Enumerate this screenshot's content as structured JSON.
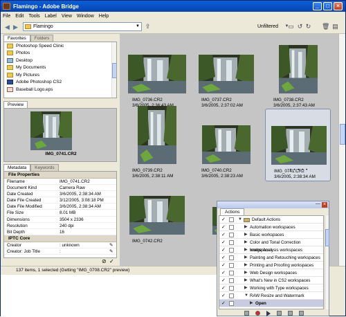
{
  "window": {
    "title": "Flamingo - Adobe Bridge"
  },
  "menu": [
    "File",
    "Edit",
    "Tools",
    "Label",
    "View",
    "Window",
    "Help"
  ],
  "toolbar": {
    "path": "Flamingo",
    "filter": "Unfiltered"
  },
  "favorites": {
    "tabs": [
      "Favorites",
      "Folders"
    ],
    "items": [
      {
        "label": "Photoshop Speed Clinic",
        "icon": "folder-icon"
      },
      {
        "label": "Photos",
        "icon": "folder-icon"
      },
      {
        "label": "Desktop",
        "icon": "desktop-icon"
      },
      {
        "label": "My Documents",
        "icon": "folder-icon"
      },
      {
        "label": "My Pictures",
        "icon": "folder-icon"
      },
      {
        "label": "Adobe Photoshop CS2",
        "icon": "application-icon"
      },
      {
        "label": "Baseball Logo.eps",
        "icon": "eps-file-icon"
      }
    ]
  },
  "preview": {
    "tab": "Preview",
    "caption": "IMG_0741.CR2"
  },
  "metadata": {
    "tabs": [
      "Metadata",
      "Keywords"
    ],
    "sections": [
      {
        "title": "File Properties",
        "rows": [
          [
            "Filename",
            "IMG_0741.CR2"
          ],
          [
            "Document Kind",
            "Camera Raw"
          ],
          [
            "Date Created",
            "3/6/2005, 2:38:34 AM"
          ],
          [
            "Date File Created",
            "3/12/2005, 3:08:18 PM"
          ],
          [
            "Date File Modified",
            "3/6/2005, 2:38:34 AM"
          ],
          [
            "File Size",
            "8.01 MB"
          ],
          [
            "Dimensions",
            "3504 x 2336"
          ],
          [
            "Resolution",
            "240 dpi"
          ],
          [
            "Bit Depth",
            "16"
          ]
        ]
      },
      {
        "title": "IPTC Core",
        "rows": [
          [
            "Creator",
            ": unknown"
          ],
          [
            "Creator: Job Title",
            ":"
          ]
        ]
      }
    ]
  },
  "thumbnails": [
    {
      "name": "IMG_0736.CR2",
      "date": "3/6/2005, 2:36:43 AM"
    },
    {
      "name": "IMG_0737.CR2",
      "date": "3/6/2005, 2:37:02 AM"
    },
    {
      "name": "IMG_0738.CR2",
      "date": "3/6/2005, 2:37:43 AM"
    },
    {
      "name": "IMG_0739.CR2",
      "date": "3/6/2005, 2:38:11 AM"
    },
    {
      "name": "IMG_0740.CR2",
      "date": "3/6/2005, 2:38:23 AM"
    },
    {
      "name": "IMG_0741.CR2",
      "date": "3/6/2005, 2:38:34 AM",
      "selected": true
    },
    {
      "name": "IMG_0742.CR2",
      "date": ""
    },
    {
      "name": "",
      "date": ""
    }
  ],
  "status": "137 items, 1 selected (Getting \"IMG_0708.CR2\" preview)",
  "actions": {
    "tab": "Actions",
    "set": "Default Actions",
    "items": [
      "Automation workspaces",
      "Basic workspaces",
      "Color and Tonal Correction workspaces",
      "Image Analysis workspaces",
      "Painting and Retouching workspaces",
      "Printing and Proofing workspaces",
      "Web Design workspaces",
      "What's New in CS2 workspaces",
      "Working with Type workspaces",
      "RAW Resize and Watermark"
    ],
    "open_item": "Open"
  }
}
